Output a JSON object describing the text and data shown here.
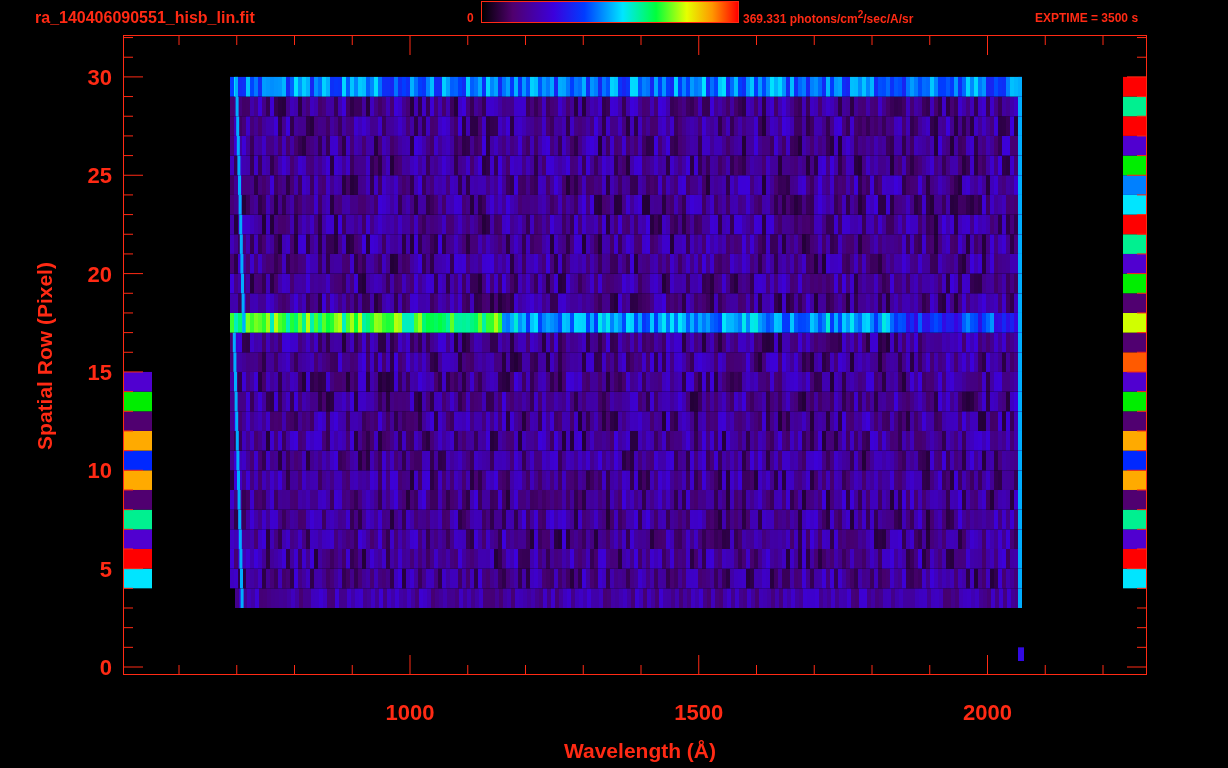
{
  "header": {
    "title": "ra_140406090551_hisb_lin.fit",
    "colorbar_min": "0",
    "colorbar_max": "369.331 photons/cm$^{2}$/sec/A/sr",
    "exposure": "EXPTIME = 3500 s"
  },
  "y_axis": {
    "label": "Spatial Row (Pixel)",
    "ticks": [
      "30",
      "25",
      "20",
      "15",
      "10",
      "5",
      "0"
    ]
  },
  "x_axis": {
    "label": "Wavelength (Å)",
    "ticks": [
      "1000",
      "1500",
      "2000"
    ]
  }
}
